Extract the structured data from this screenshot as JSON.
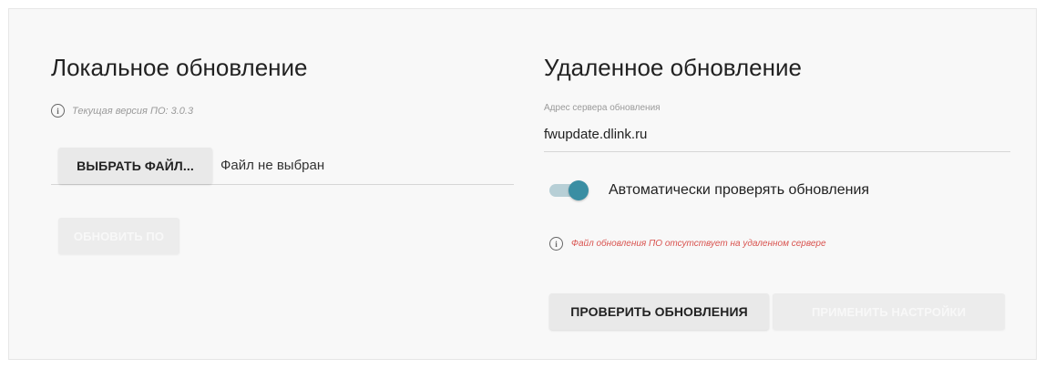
{
  "local": {
    "title": "Локальное обновление",
    "version_info": "Текущая версия ПО: 3.0.3",
    "choose_file_label": "ВЫБРАТЬ ФАЙЛ...",
    "file_status": "Файл не выбран",
    "update_button_label": "ОБНОВИТЬ ПО",
    "update_button_enabled": false
  },
  "remote": {
    "title": "Удаленное обновление",
    "server_address_label": "Адрес сервера обновления",
    "server_address_value": "fwupdate.dlink.ru",
    "auto_check_label": "Автоматически проверять обновления",
    "auto_check_enabled": true,
    "warning_text": "Файл обновления ПО отсутствует на удаленном сервере",
    "check_button_label": "ПРОВЕРИТЬ ОБНОВЛЕНИЯ",
    "apply_button_label": "ПРИМЕНИТЬ НАСТРОЙКИ",
    "apply_button_enabled": false
  },
  "icons": {
    "info": "info-icon",
    "warning": "info-icon"
  },
  "colors": {
    "toggle_on": "#3a8ea3",
    "warning": "#d9534f",
    "muted": "#9a9a9a"
  }
}
